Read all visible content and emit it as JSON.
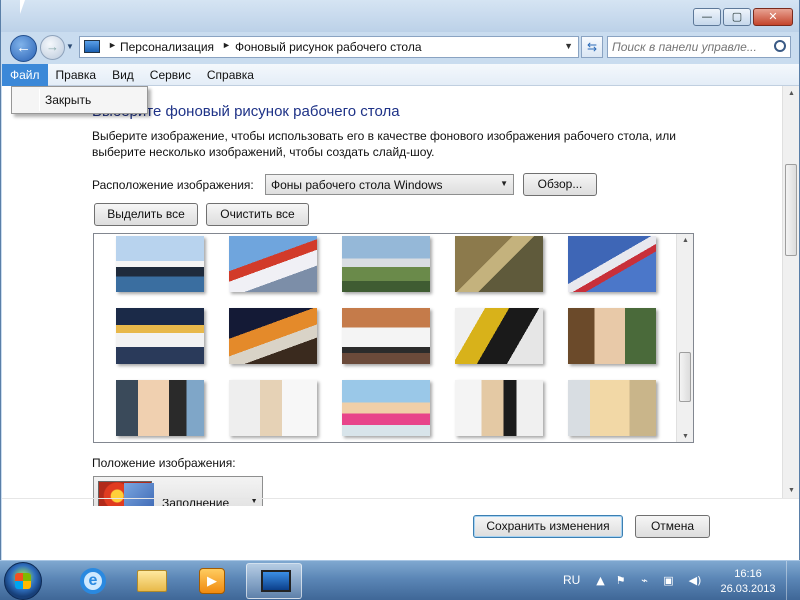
{
  "window": {
    "caption": {
      "minimize": "—",
      "maximize": "▢",
      "close": "✕"
    }
  },
  "nav": {
    "back_glyph": "←",
    "forward_glyph": "→",
    "breadcrumb": [
      "Персонализация",
      "Фоновый рисунок рабочего стола"
    ],
    "search_placeholder": "Поиск в панели управле..."
  },
  "menubar": [
    "Файл",
    "Правка",
    "Вид",
    "Сервис",
    "Справка"
  ],
  "file_menu": {
    "items": [
      "Закрыть"
    ]
  },
  "content": {
    "heading": "Выберите фоновый рисунок рабочего стола",
    "description": "Выберите изображение, чтобы использовать его в качестве фонового изображения рабочего стола, или выберите несколько изображений, чтобы создать слайд-шоу.",
    "location_label": "Расположение изображения:",
    "location_value": "Фоны рабочего стола Windows",
    "browse_button": "Обзор...",
    "select_all_button": "Выделить все",
    "clear_all_button": "Очистить все",
    "position_label": "Положение изображения:",
    "position_value": "Заполнение",
    "save_button": "Сохранить изменения",
    "cancel_button": "Отмена"
  },
  "gallery": [
    {
      "name": "ship-thumbnail",
      "bg": "linear-gradient(#b8d3ee 0 45%, #f5f5f5 45% 55%, #1f2b3c 55% 72%, #3a6ea0 72%)"
    },
    {
      "name": "helicopter-thumbnail",
      "bg": "linear-gradient(160deg, #6fa5dd 0 40%, #d23b2a 40% 52%, #f0f0f5 52% 70%, #7c8ea8 70%)"
    },
    {
      "name": "cargo-plane-thumbnail",
      "bg": "linear-gradient(#95b8d8 0 40%, #d9dde2 40% 55%, #6a8a4a 55% 80%, #3f5c32 80%)"
    },
    {
      "name": "fighter-jet-thumbnail",
      "bg": "linear-gradient(135deg, #8c7a4c 0 40%, #c4b27d 40% 55%, #5f5a3b 55% 100%)"
    },
    {
      "name": "aerobatic-jet-thumbnail",
      "bg": "linear-gradient(150deg, #3e66b6 0 45%, #e8e8ee 45% 55%, #c8303a 55% 62%, #4b77c9 62%)"
    },
    {
      "name": "airliner-thumbnail",
      "bg": "linear-gradient(#1b2a48 0 30%, #e8b84a 30% 45%, #f2f2f2 45% 70%, #2a3a5a 70%)"
    },
    {
      "name": "business-jet-thumbnail",
      "bg": "linear-gradient(160deg, #141a36 0 35%, #e48a2a 35% 55%, #d9d3c7 55% 70%, #3a2a1e 70%)"
    },
    {
      "name": "suv-thumbnail",
      "bg": "linear-gradient(#c57b4a 0 35%, #f4f4f4 35% 70%, #2b2b2b 70% 80%, #6b4a3a 80%)"
    },
    {
      "name": "motorcycle-thumbnail",
      "bg": "linear-gradient(120deg, #f0f0f0 0 25%, #d8b21a 25% 45%, #1a1a1a 45% 70%, #e6e6e6 70%)"
    },
    {
      "name": "woman-hat-thumbnail",
      "bg": "linear-gradient(90deg, #6b4a2a 0 30%, #e8c9a8 30% 65%, #4a6a3a 65%)"
    },
    {
      "name": "woman-camera-thumbnail",
      "bg": "linear-gradient(90deg, #3a4a5a 0 25%, #f0d0b0 25% 60%, #2a2a2a 60% 80%, #7fa6c8 80%)"
    },
    {
      "name": "woman-dress-thumbnail",
      "bg": "linear-gradient(90deg, #eeeeee 0 35%, #e6d2b6 35% 60%, #f7f7f7 60%)"
    },
    {
      "name": "woman-pink-thumbnail",
      "bg": "linear-gradient(#9ac8e8 0 40%, #f0cfa8 40% 60%, #e8448a 60% 80%, #d8e4ea 80%)"
    },
    {
      "name": "woman-black-thumbnail",
      "bg": "linear-gradient(90deg, #f4f4f4 0 30%, #e4c9a4 30% 55%, #1c1c1c 55% 70%, #f0f0f0 70%)"
    },
    {
      "name": "woman-smile-thumbnail",
      "bg": "linear-gradient(90deg, #d8dde2 0 25%, #f2d8a6 25% 70%, #c9b58a 70%)"
    }
  ],
  "taskbar": {
    "language": "RU",
    "time": "16:16",
    "date": "26.03.2013",
    "ie_glyph": "e",
    "media_glyph": "▶",
    "tray": {
      "flag": "⚑",
      "power": "⌁",
      "network": "▣",
      "volume": "◀)"
    }
  }
}
